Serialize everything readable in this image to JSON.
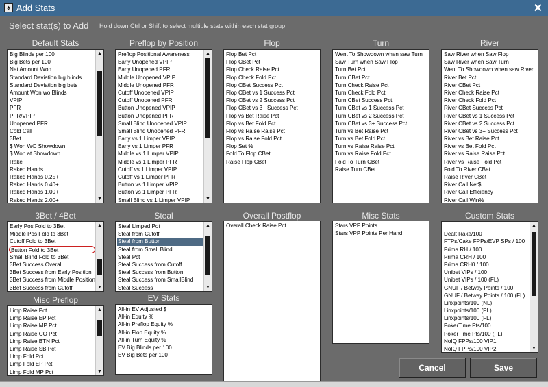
{
  "window": {
    "title": "Add Stats",
    "app_icon": "♠"
  },
  "dialog": {
    "heading": "Select stat(s) to Add",
    "hint": "Hold down Ctrl or Shift to select multiple stats within each stat group"
  },
  "groups": {
    "default_stats": {
      "label": "Default Stats",
      "items": [
        "Big Blinds per 100",
        "Big Bets per 100",
        "Net Amount Won",
        "Standard Deviation big blinds",
        "Standard Deviation big bets",
        "Amount Won wo Blinds",
        "VPIP",
        "PFR",
        "PFR/VPIP",
        "Unopened PFR",
        "Cold Call",
        "3Bet",
        "$ Won WO Showdown",
        "$ Won at Showdown",
        "Rake",
        "Raked Hands",
        "Raked Hands 0.25+",
        "Raked Hands 0.40+",
        "Raked Hands 1.00+",
        "Raked Hands 2.00+"
      ]
    },
    "preflop_by_position": {
      "label": "Preflop by Position",
      "items": [
        "Preflop Positional Awareness",
        "Early Unopened VPIP",
        "Early Unopened PFR",
        "Middle Unopened VPIP",
        "Middle Unopened PFR",
        "Cutoff Unopened VPIP",
        "Cutoff Unopened PFR",
        "Button Unopened VPIP",
        "Button Unopened PFR",
        "Small Blind Unopened VPIP",
        "Small Blind Unopened PFR",
        "Early vs 1 Limper VPIP",
        "Early vs 1 Limper PFR",
        "Middle vs 1 Limper VPIP",
        "Middle vs 1 Limper PFR",
        "Cutoff vs 1 Limper VPIP",
        "Cutoff vs 1 Limper PFR",
        "Button vs 1 Limper VPIP",
        "Button vs 1 Limper PFR",
        "Small Blind vs 1 Limper VPIP"
      ]
    },
    "flop": {
      "label": "Flop",
      "items": [
        "Flop Bet Pct",
        "Flop CBet Pct",
        "Flop Check Raise Pct",
        "Flop Check Fold Pct",
        "Flop CBet Success Pct",
        "Flop CBet vs 1 Success Pct",
        "Flop CBet vs 2 Success Pct",
        "Flop CBet vs 3+ Success Pct",
        "Flop vs Bet Raise Pct",
        "Flop vs Bet Fold Pct",
        "Flop vs Raise Raise Pct",
        "Flop vs Raise Fold Pct",
        "Flop Set %",
        "Fold To Flop CBet",
        "Raise Flop CBet"
      ]
    },
    "turn": {
      "label": "Turn",
      "items": [
        "Went To Showdown when saw Turn",
        "Saw Turn when Saw Flop",
        "Turn Bet Pct",
        "Turn CBet Pct",
        "Turn Check Raise Pct",
        "Turn Check Fold Pct",
        "Turn CBet Success Pct",
        "Turn CBet vs 1 Success Pct",
        "Turn CBet vs 2 Success Pct",
        "Turn CBet vs 3+ Success Pct",
        "Turn vs Bet Raise Pct",
        "Turn vs Bet Fold Pct",
        "Turn vs Raise Raise Pct",
        "Turn vs Raise Fold Pct",
        "Fold To Turn CBet",
        "Raise Turn CBet"
      ]
    },
    "river": {
      "label": "River",
      "items": [
        "Saw River when Saw Flop",
        "Saw River when Saw Turn",
        "Went To Showdown when saw River",
        "River Bet Pct",
        "River CBet Pct",
        "River Check Raise Pct",
        "River Check Fold Pct",
        "River CBet Success Pct",
        "River CBet vs 1 Success Pct",
        "River CBet vs 2 Success Pct",
        "River CBet vs 3+ Success Pct",
        "River vs Bet Raise Pct",
        "River vs Bet Fold Pct",
        "River vs Raise Raise Pct",
        "River vs Raise Fold Pct",
        "Fold To River CBet",
        "Raise River CBet",
        "River Call Net$",
        "River Call Efficiency",
        "River Call Win%"
      ]
    },
    "threebet": {
      "label": "3Bet / 4Bet",
      "items": [
        "Early Pos Fold to 3Bet",
        "Middle Pos Fold to 3Bet",
        "Cutoff Fold to 3Bet",
        "Button Fold to 3Bet",
        "Small Blind Fold to 3Bet",
        "3Bet Success Overall",
        "3Bet Success from Early Position",
        "3Bet Success from Middle Position",
        "3Bet Success from Cutoff"
      ]
    },
    "steal": {
      "label": "Steal",
      "items": [
        "Steal Limped Pot",
        "Steal from Cutoff",
        "Steal from Button",
        "Steal from Small Blind",
        "Steal Pct",
        "Steal Success from Cutoff",
        "Steal Success from Button",
        "Steal Success from SmallBlind",
        "Steal Success"
      ]
    },
    "overall_postflop": {
      "label": "Overall Postflop",
      "items": [
        "Overall Check Raise Pct"
      ]
    },
    "misc_stats": {
      "label": "Misc Stats",
      "items": [
        "Stars VPP Points",
        "Stars VPP Points Per Hand"
      ]
    },
    "custom_stats": {
      "label": "Custom Stats",
      "items": [
        "",
        "Dealt Rake/100",
        "FTPs/Cake FPPs/EVP SPs / 100",
        "Prima RH / 100",
        "Prima CRH / 100",
        "Prima CRH0 / 100",
        "Unibet VIPs / 100",
        "Unibet VIPs / 100 (FL)",
        "GNUF / Betway Points / 100",
        "GNUF / Betway Points / 100 (FL)",
        "Linxpoints/100 (NL)",
        "Linxpoints/100 (PL)",
        "Linxpoints/100 (FL)",
        "PokerTime Pts/100",
        "PokerTime Pts/100 (FL)",
        "NoIQ FPPs/100 VIP1",
        "NoIQ FPPs/100 VIP2"
      ]
    },
    "misc_preflop": {
      "label": "Misc Preflop",
      "items": [
        "Limp Raise Pct",
        "Limp Raise EP Pct",
        "Limp Raise MP Pct",
        "Limp Raise CO Pct",
        "Limp Raise BTN Pct",
        "Limp Raise SB Pct",
        "Limp Fold Pct",
        "Limp Fold EP Pct",
        "Limp Fold MP Pct"
      ]
    },
    "ev_stats": {
      "label": "EV Stats",
      "items": [
        "All-in EV Adjusted $",
        "All-in Equity %",
        "All-in Preflop Equity %",
        "All-in Flop Equity %",
        "All-in Turn Equity %",
        "EV Big Blinds per 100",
        "EV Big Bets per 100"
      ]
    }
  },
  "buttons": {
    "cancel": "Cancel",
    "save": "Save"
  },
  "colors": {
    "title_bar": "#3c6a93",
    "dialog_bg": "#6b6b6b",
    "selected_item": "#4e6a84",
    "highlight_ring": "#cc2020"
  }
}
